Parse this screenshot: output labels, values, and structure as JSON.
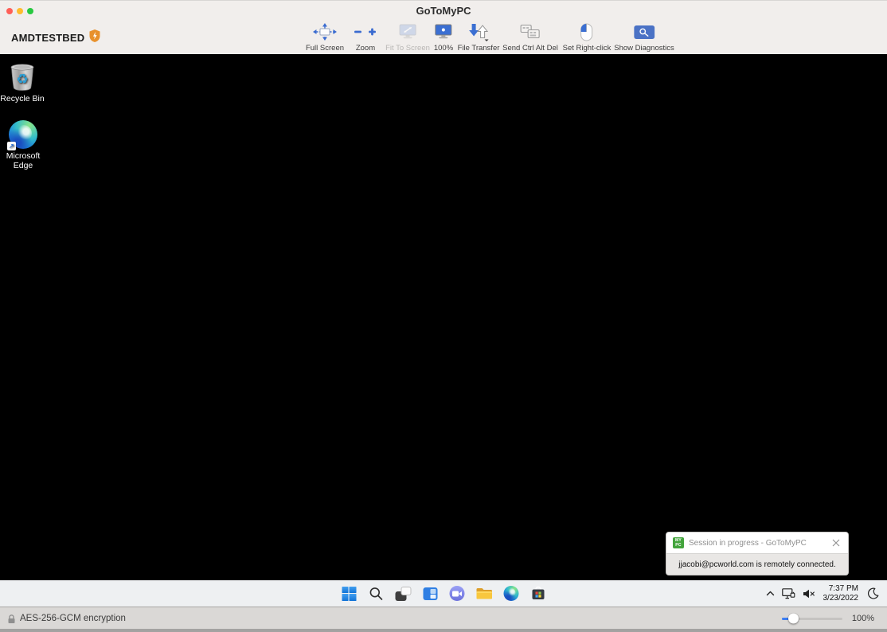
{
  "window": {
    "title": "GoToMyPC"
  },
  "toolbar": {
    "host_name": "AMDTESTBED",
    "host_icon": "shield-icon",
    "buttons": [
      {
        "label": "Full Screen",
        "icon": "full-screen-icon",
        "enabled": true
      },
      {
        "label": "Zoom",
        "icon": "zoom-minus-plus-icon",
        "enabled": true
      },
      {
        "label": "Fit To Screen",
        "icon": "fit-to-screen-icon",
        "enabled": false
      },
      {
        "label": "100%",
        "icon": "monitor-100-icon",
        "enabled": true
      },
      {
        "label": "File Transfer",
        "icon": "file-transfer-icon",
        "enabled": true
      },
      {
        "label": "Send Ctrl Alt Del",
        "icon": "send-ctrl-alt-del-icon",
        "enabled": true
      },
      {
        "label": "Set Right-click",
        "icon": "mouse-icon",
        "enabled": true
      },
      {
        "label": "Show Diagnostics",
        "icon": "diagnostics-magnifier-icon",
        "enabled": true
      }
    ]
  },
  "desktop": {
    "icons": [
      {
        "label": "Recycle Bin",
        "icon": "recycle-bin-icon"
      },
      {
        "label": "Microsoft Edge",
        "icon": "edge-icon"
      }
    ]
  },
  "notification": {
    "app_icon": "gotomypc-logo-icon",
    "title": "Session in progress - GoToMyPC",
    "message": "jjacobi@pcworld.com is remotely connected."
  },
  "taskbar": {
    "icons": [
      "start-icon",
      "search-icon",
      "task-view-icon",
      "widgets-icon",
      "chat-icon",
      "file-explorer-icon",
      "edge-icon",
      "store-icon"
    ],
    "tray": {
      "icons": [
        "chevron-up-icon",
        "network-monitor-icon",
        "speaker-muted-icon",
        "moon-icon"
      ],
      "time": "7:37 PM",
      "date": "3/23/2022"
    }
  },
  "statusbar": {
    "encryption_label": "AES-256-GCM encryption",
    "zoom_value": "100%"
  },
  "colors": {
    "accent_blue": "#3b6fd2",
    "chrome_bg": "#f1eeec",
    "taskbar_bg": "#eef0f2",
    "statusbar_bg": "#dad8d6",
    "toast_green": "#43a43c",
    "shield_orange": "#e8912d"
  }
}
